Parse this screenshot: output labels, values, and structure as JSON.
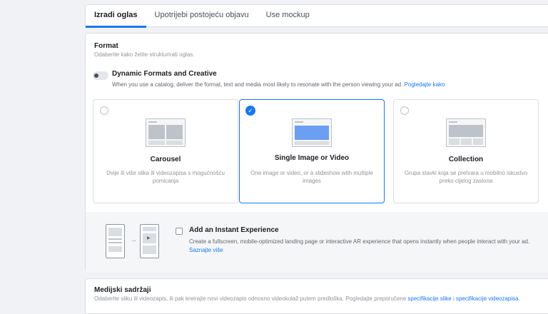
{
  "tabs": [
    {
      "label": "Izradi oglas",
      "active": true
    },
    {
      "label": "Upotrijebi postojeću objavu",
      "active": false
    },
    {
      "label": "Use mockup",
      "active": false
    }
  ],
  "format": {
    "title": "Format",
    "subtitle": "Odaberite kako želite strukturirati oglas.",
    "dynamic": {
      "title": "Dynamic Formats and Creative",
      "description": "When you use a catalog, deliver the format, text and media most likely to resonate with the person viewing your ad.",
      "link": "Pogledajte kako",
      "enabled": false
    },
    "options": [
      {
        "title": "Carousel",
        "description": "Dvije ili više slika ili videozapisa s mogućnošću pomicanja",
        "selected": false,
        "icon": "carousel-thumbnail-icon"
      },
      {
        "title": "Single Image or Video",
        "description": "One image or video, or a slideshow with multiple images",
        "selected": true,
        "icon": "single-image-thumbnail-icon"
      },
      {
        "title": "Collection",
        "description": "Grupa stavki koja se pretvara u mobilno iskustvo preko cijelog zaslona",
        "selected": false,
        "icon": "collection-thumbnail-icon"
      }
    ],
    "instant": {
      "title": "Add an Instant Experience",
      "description": "Create a fullscreen, mobile-optimized landing page or interactive AR experience that opens instantly when people interact with your ad.",
      "link": "Saznajte više",
      "checked": false
    }
  },
  "media": {
    "title": "Medijski sadržaji",
    "subtitle": "Odaberite sliku ili videozapis, ili pak kreirajte novi videozapis odnosno videokolaž putem predloška. Pogledajte preporučene",
    "link1": "specifikacije slike",
    "joiner": "i",
    "link2": "specifikacije videozapisa",
    "end": "."
  },
  "colors": {
    "accent": "#1877f2",
    "background": "#f0f2f5"
  }
}
